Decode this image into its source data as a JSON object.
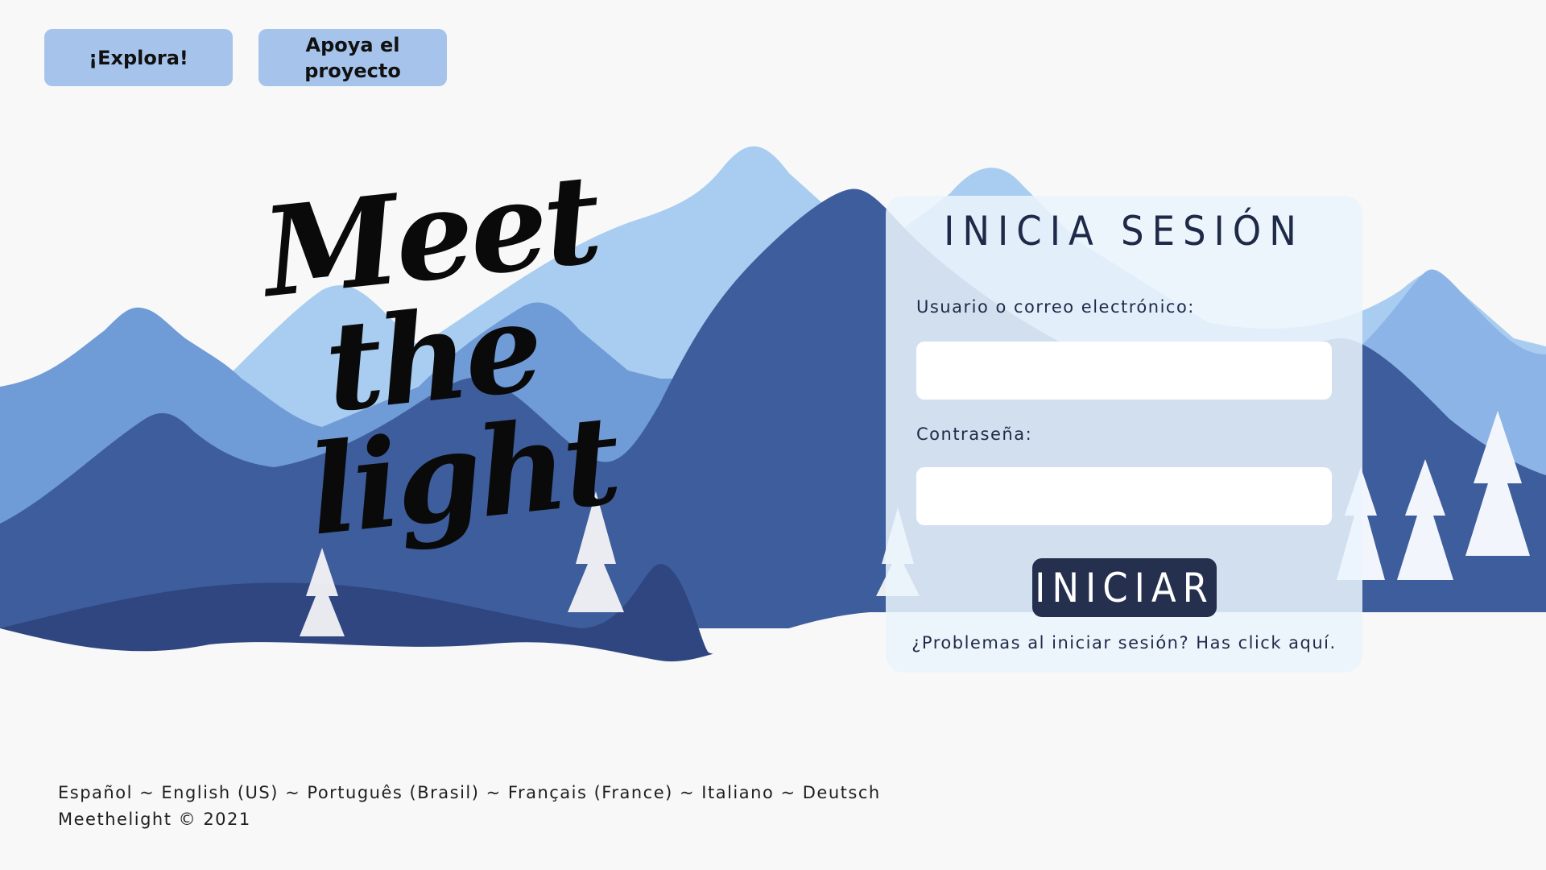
{
  "nav": {
    "explore_label": "¡Explora!",
    "support_label": "Apoya el proyecto"
  },
  "hero": {
    "title_line1": "Meet",
    "title_line2": "the",
    "title_line3": "light"
  },
  "login": {
    "title": "INICIA SESIÓN",
    "username_label": "Usuario o correo electrónico:",
    "username_value": "",
    "password_label": "Contraseña:",
    "password_value": "",
    "submit_label": "INICIAR",
    "help_text": "¿Problemas al iniciar sesión? Has click aquí."
  },
  "footer": {
    "languages": [
      "Español",
      "English (US)",
      "Português (Brasil)",
      "Français (France)",
      "Italiano",
      "Deutsch"
    ],
    "separator": " ~ ",
    "copyright": "Meethelight © 2021"
  },
  "colors": {
    "background": "#f8f8f8",
    "button_light": "#a6c4eb",
    "button_dark": "#25304f",
    "text_dark": "#1e2a48",
    "mountain_light": "#a8cdf0",
    "mountain_mid": "#6f9bd7",
    "mountain_dark": "#3e5d9c",
    "mountain_darkest": "#2f4680"
  }
}
